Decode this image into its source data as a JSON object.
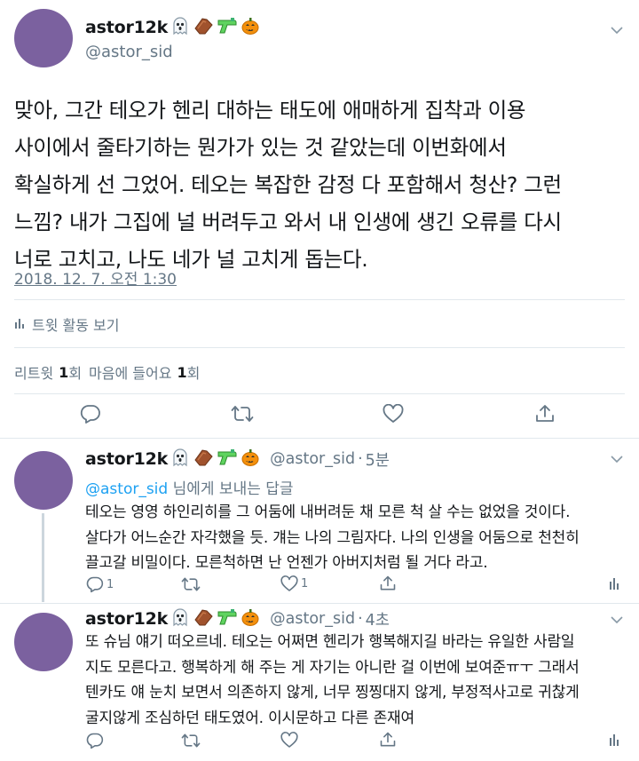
{
  "main_tweet": {
    "name": "astor12k",
    "name_emojis": [
      "ghost-emoji",
      "coffin-emoji",
      "water-pistol-emoji",
      "jack-o-lantern-emoji"
    ],
    "handle": "@astor_sid",
    "text": "맞아, 그간 테오가 헨리 대하는 태도에 애매하게 집착과 이용\n사이에서 줄타기하는 뭔가가 있는 것 같았는데 이번화에서\n확실하게 선 그었어. 테오는 복잡한 감정 다 포함해서 청산? 그런\n느낌? 내가 그집에 널 버려두고 와서 내 인생에 생긴 오류를 다시\n너로 고치고, 나도 네가 널 고치게 돕는다.",
    "timestamp": "2018. 12. 7. 오전 1:30",
    "activity_label": "트윗 활동 보기",
    "stats": {
      "retweet_label": "리트윗",
      "retweet_count": "1",
      "retweet_unit": "회",
      "like_label": "마음에 들어요",
      "like_count": "1",
      "like_unit": "회"
    }
  },
  "replies": [
    {
      "name": "astor12k",
      "handle": "@astor_sid",
      "time": "5분",
      "replying_to": "@astor_sid",
      "replying_suffix": " 님에게 보내는 답글",
      "text": "테오는 영영 하인리히를 그 어둠에 내버려둔 채 모른 척 살 수는 없었을 것이다.\n살다가 어느순간 자각했을 듯. 걔는 나의 그림자다. 나의 인생을 어둠으로 천천히\n끌고갈 비밀이다. 모른척하면 난 언젠가 아버지처럼 될 거다 라고.",
      "reply_count": "1",
      "like_count": "1"
    },
    {
      "name": "astor12k",
      "handle": "@astor_sid",
      "time": "4초",
      "text": "또 슈님 얘기 떠오르네. 테오는 어쩌면 헨리가 행복해지길 바라는 유일한 사람일\n지도 모른다고. 행복하게 해 주는 게 자기는 아니란 걸 이번에 보여준ㅠㅜ 그래서\n텐카도 얘 눈치 보면서 의존하지 않게, 너무 찡찡대지 않게, 부정적사고로 귀찮게\n굴지않게 조심하던 태도였어. 이시문하고 다른 존재여",
      "reply_count": "",
      "like_count": ""
    }
  ],
  "colors": {
    "avatar": "#7b619f",
    "link": "#1da1f2",
    "secondary": "#657786",
    "divider": "#e1e8ed"
  }
}
